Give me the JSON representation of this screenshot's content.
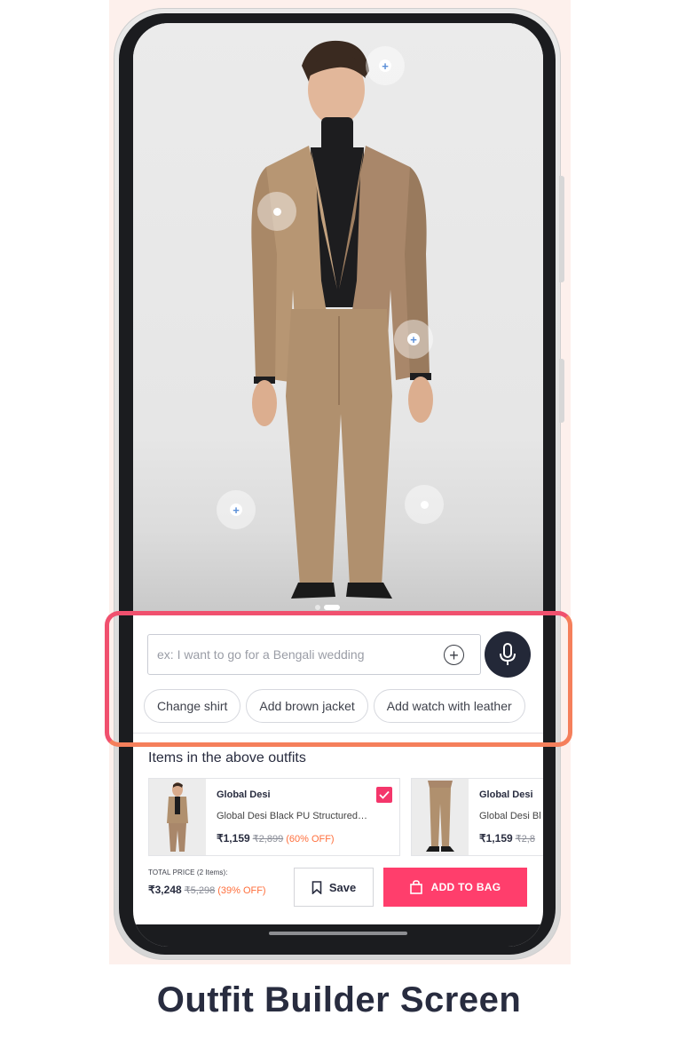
{
  "photo": {
    "hotspots": [
      {
        "name": "hotspot-add-1",
        "kind": "add"
      },
      {
        "name": "hotspot-dot-1",
        "kind": "dot"
      },
      {
        "name": "hotspot-add-2",
        "kind": "add"
      },
      {
        "name": "hotspot-add-3",
        "kind": "add"
      },
      {
        "name": "hotspot-dot-2",
        "kind": "dot"
      }
    ],
    "page_count": 2,
    "active_page": 2
  },
  "search": {
    "placeholder": "ex: I want to go for a Bengali wedding",
    "add_icon": "plus-circle-icon",
    "mic_icon": "microphone-icon"
  },
  "suggestions": [
    "Change shirt",
    "Add brown jacket",
    "Add watch with leather"
  ],
  "items_section": {
    "title": "Items in the above outfits",
    "items": [
      {
        "brand": "Global Desi",
        "name": "Global Desi Black PU Structured…",
        "price": "₹1,159",
        "mrp": "₹2,899",
        "discount": "(60% OFF)",
        "checked": true
      },
      {
        "brand": "Global Desi",
        "name": "Global Desi Bl",
        "price": "₹1,159",
        "mrp": "₹2,8",
        "discount": "",
        "checked": false
      }
    ]
  },
  "footer": {
    "total_label": "TOTAL PRICE (2 Items):",
    "total_price": "₹3,248",
    "total_mrp": "₹5,298",
    "total_discount": "(39% OFF)",
    "save_label": "Save",
    "bag_label": "ADD TO BAG"
  },
  "caption": "Outfit Builder Screen",
  "colors": {
    "accent_pink": "#ff3e6c",
    "discount_orange": "#ff6f3c",
    "mic_navy": "#232838",
    "highlight_gradient_start": "#f0506e",
    "highlight_gradient_end": "#f57f5b"
  }
}
